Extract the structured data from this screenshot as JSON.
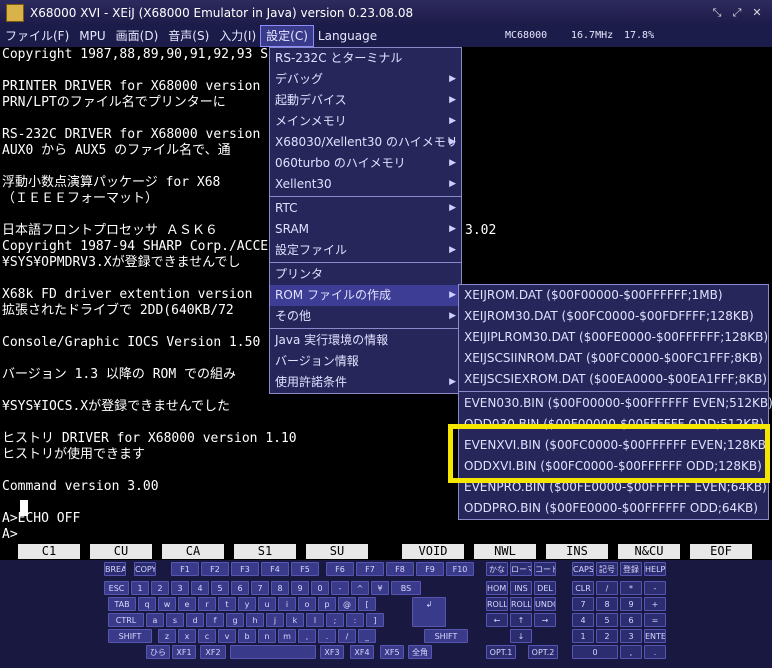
{
  "window": {
    "title": "X68000 XVI - XEiJ (X68000 Emulator in Java) version 0.23.08.08",
    "buttons": [
      "⤡",
      "⤢",
      "✕"
    ]
  },
  "menubar": {
    "items": [
      "ファイル(F)",
      "MPU",
      "画面(D)",
      "音声(S)",
      "入力(I)",
      "設定(C)",
      "Language"
    ],
    "status_model": "MC68000",
    "status_clock": "16.7MHz",
    "status_load": "17.8%"
  },
  "terminal": {
    "lines": [
      "Copyright 1987,88,89,90,91,92,93 SH",
      "",
      "PRINTER DRIVER for X68000 version",
      "PRN/LPTのファイル名でプリンターに",
      "",
      "RS-232C DRIVER for X68000 version",
      "AUX0 から AUX5 のファイル名で、通",
      "",
      "浮動小数点演算パッケージ for X68",
      "（ＩＥＥＥフォーマット）",
      "",
      "日本語フロントプロセッサ ＡＳＫ６",
      "Copyright 1987-94 SHARP Corp./ACCE",
      "¥SYS¥OPMDRV3.Xが登録できませんでし",
      "",
      "X68k FD driver extention version",
      "拡張されたドライブで 2DD(640KB/72",
      "",
      "Console/Graphic IOCS Version 1.50",
      "",
      "バージョン 1.3 以降の ROM での組み",
      "",
      "¥SYS¥IOCS.Xが登録できませんでした",
      "",
      "ヒストリ DRIVER for X68000 version 1.10",
      "ヒストリが使用できます",
      "",
      "Command version 3.00",
      "",
      "A>ECHO OFF",
      "A>"
    ],
    "frag_3_02": "3.02"
  },
  "settings_menu": {
    "items": [
      {
        "label": "RS-232C とターミナル",
        "sub": false
      },
      {
        "label": "デバッグ",
        "sub": true
      },
      {
        "label": "起動デバイス",
        "sub": true
      },
      {
        "label": "メインメモリ",
        "sub": true
      },
      {
        "label": "X68030/Xellent30 のハイメモリ",
        "sub": true
      },
      {
        "label": "060turbo のハイメモリ",
        "sub": true
      },
      {
        "label": "Xellent30",
        "sub": true
      },
      {
        "label": "RTC",
        "sub": true
      },
      {
        "label": "SRAM",
        "sub": true
      },
      {
        "label": "設定ファイル",
        "sub": true
      },
      {
        "label": "プリンタ",
        "sub": false
      },
      {
        "label": "ROM ファイルの作成",
        "sub": true
      },
      {
        "label": "その他",
        "sub": true
      },
      {
        "label": "Java 実行環境の情報",
        "sub": false
      },
      {
        "label": "バージョン情報",
        "sub": false
      },
      {
        "label": "使用許諾条件",
        "sub": true
      }
    ]
  },
  "rom_menu": {
    "items": [
      "XEIJROM.DAT ($00F00000-$00FFFFFF;1MB)",
      "XEIJROM30.DAT ($00FC0000-$00FDFFFF;128KB)",
      "XEIJIPLROM30.DAT ($00FE0000-$00FFFFFF;128KB)",
      "XEIJSCSIINROM.DAT ($00FC0000-$00FC1FFF;8KB)",
      "XEIJSCSIEXROM.DAT ($00EA0000-$00EA1FFF;8KB)",
      "EVEN030.BIN ($00F00000-$00FFFFFF EVEN;512KB)",
      "ODD030.BIN ($00F00000-$00FFFFFF ODD;512KB)",
      "EVENXVI.BIN ($00FC0000-$00FFFFFF EVEN;128KB)",
      "ODDXVI.BIN ($00FC0000-$00FFFFFF ODD;128KB)",
      "EVENPRO.BIN ($00FE0000-$00FFFFFF EVEN;64KB)",
      "ODDPRO.BIN ($00FE0000-$00FFFFFF ODD;64KB)"
    ]
  },
  "function_keys": [
    "C1",
    "CU",
    "CA",
    "S1",
    "SU",
    "VOID",
    "NWL",
    "INS",
    "N&CU",
    "EOF"
  ],
  "keyboard": {
    "row0": [
      "BREAK",
      "COPY",
      "F1",
      "F2",
      "F3",
      "F4",
      "F5",
      "F6",
      "F7",
      "F8",
      "F9",
      "F10",
      "かな",
      "ローマ",
      "コード",
      "CAPS",
      "記号",
      "登録",
      "HELP"
    ],
    "row1": [
      "ESC",
      "1",
      "2",
      "3",
      "4",
      "5",
      "6",
      "7",
      "8",
      "9",
      "0",
      "-",
      "^",
      "¥",
      "BS",
      "HOME",
      "INS",
      "DEL",
      "CLR",
      "/",
      "*",
      "-"
    ],
    "row2": [
      "TAB",
      "q",
      "w",
      "e",
      "r",
      "t",
      "y",
      "u",
      "i",
      "o",
      "p",
      "@",
      "[",
      "ROLL UP",
      "ROLL DOWN",
      "UNDO",
      "7",
      "8",
      "9",
      "+"
    ],
    "row3": [
      "CTRL",
      "a",
      "s",
      "d",
      "f",
      "g",
      "h",
      "j",
      "k",
      "l",
      ";",
      ":",
      "]",
      "←",
      "↑",
      "→",
      "4",
      "5",
      "6",
      "="
    ],
    "row4": [
      "SHIFT",
      "z",
      "x",
      "c",
      "v",
      "b",
      "n",
      "m",
      ",",
      ".",
      "/",
      "_",
      "SHIFT",
      "↓",
      "1",
      "2",
      "3",
      "ENTER"
    ],
    "row5": [
      "ひら",
      "XF1",
      "XF2",
      "",
      "XF3",
      "XF4",
      "XF5",
      "全角",
      "OPT.1",
      "OPT.2",
      "0",
      ",",
      "."
    ],
    "return_glyph": "↲"
  }
}
